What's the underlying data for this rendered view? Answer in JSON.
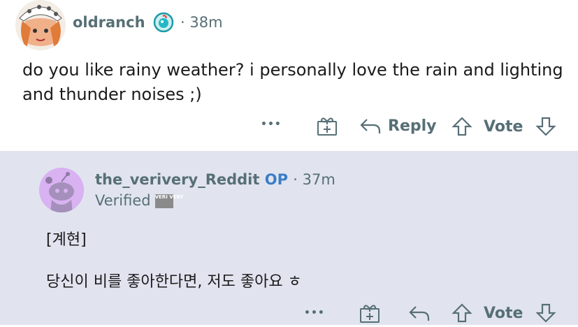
{
  "comment": {
    "username": "oldranch",
    "time": "38m",
    "text": "do you like rainy weather? i personally love the rain and lighting and thunder noises ;)",
    "actions": {
      "more": "•••",
      "reply": "Reply",
      "vote": "Vote"
    }
  },
  "reply": {
    "username": "the_verivery_Reddit",
    "op_label": "OP",
    "time": "37m",
    "flair_text": "Verified",
    "flair_badge": "VERI VERY",
    "line1": "[계현]",
    "line2": "당신이 비를 좋아한다면, 저도 좋아요 ㅎ",
    "actions": {
      "more": "•••",
      "vote": "Vote"
    }
  },
  "colors": {
    "meta": "#576f76",
    "op": "#3b7ec8",
    "reply_bg": "#e1e4ef",
    "avatar_reply_bg": "#d9b2f2"
  }
}
